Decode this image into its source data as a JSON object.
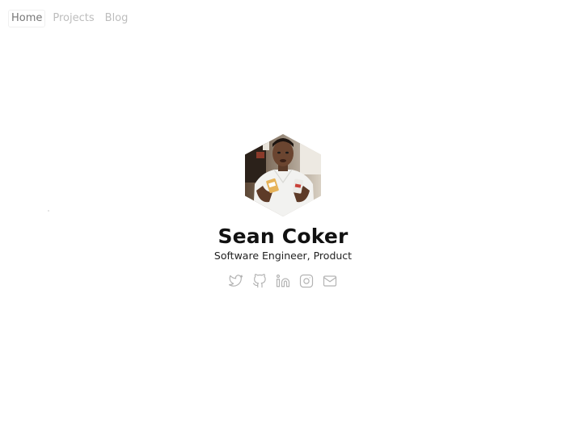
{
  "nav": {
    "items": [
      {
        "label": "Home",
        "active": true
      },
      {
        "label": "Projects",
        "active": false
      },
      {
        "label": "Blog",
        "active": false
      }
    ]
  },
  "profile": {
    "name": "Sean Coker",
    "tagline": "Software Engineer, Product",
    "avatar_icon": "hexagon-portrait-photo"
  },
  "socials": [
    {
      "icon": "twitter-icon"
    },
    {
      "icon": "github-icon"
    },
    {
      "icon": "linkedin-icon"
    },
    {
      "icon": "instagram-icon"
    },
    {
      "icon": "email-icon"
    }
  ],
  "colors": {
    "background": "#ffffff",
    "nav_active": "#777777",
    "nav_inactive": "#bdbdbd",
    "name": "#111111",
    "icon": "#b3b3b3"
  }
}
